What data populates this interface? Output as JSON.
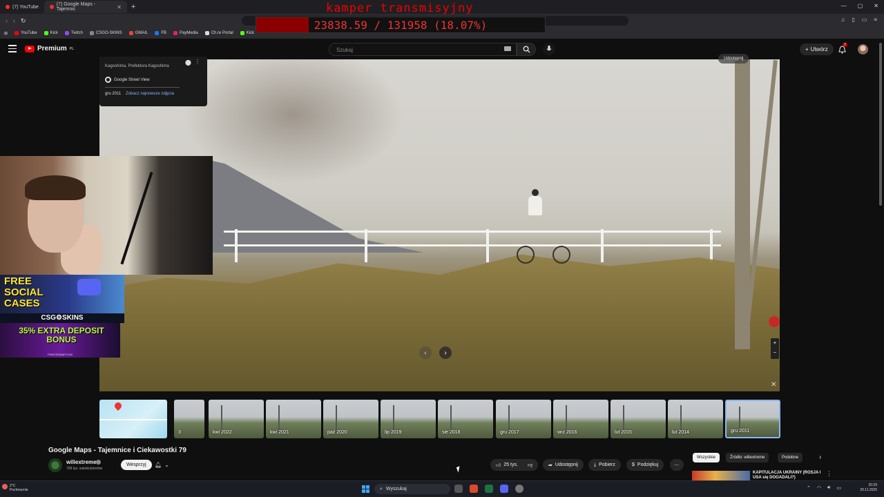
{
  "browser": {
    "tabs": [
      {
        "label": "(7) YouTube",
        "active": false
      },
      {
        "label": "(7) Google Maps - Tajemnic",
        "active": true
      }
    ],
    "bookmarks": [
      "YouTube",
      "Kick",
      "Twitch",
      "CSGO-SKINS",
      "GMAIL",
      "FB",
      "PayMedia",
      "Ch.re Portal",
      "Kick"
    ]
  },
  "stream_overlay": {
    "title": "kamper transmisyjny",
    "goal_text": "23838.59 / 131958 (18.07%)",
    "goal_fraction": 0.1807,
    "accent": "#e00000"
  },
  "youtube": {
    "logo": "Premium",
    "region": "PL",
    "search_placeholder": "Szukaj",
    "create_label": "Utwórz",
    "notifications_count": "7"
  },
  "street_view_card": {
    "place": "Kagoshima, Prefektura Kagoshima",
    "provider": "Google Street View",
    "date": "gru 2011",
    "newer_link": "Zobacz najnowsze zdjęcia",
    "share_label": "Udostępnij"
  },
  "ads": {
    "social_cases": "FREE SOCIAL CASES",
    "csgo_skins": "CSG⚙SKINS",
    "pirate_bonus": "35% EXTRA DEPOSIT BONUS",
    "pirate_site": "PIRATESWAP.COM"
  },
  "timeline": [
    {
      "label": "",
      "kind": "map"
    },
    {
      "label": "3",
      "kind": "partial"
    },
    {
      "label": "kwi 2022"
    },
    {
      "label": "kwi 2021"
    },
    {
      "label": "paź 2020"
    },
    {
      "label": "lip 2019"
    },
    {
      "label": "sie 2018"
    },
    {
      "label": "gru 2017"
    },
    {
      "label": "wrz 2016"
    },
    {
      "label": "lut 2015"
    },
    {
      "label": "lut 2014"
    },
    {
      "label": "gru 2011",
      "selected": true
    }
  ],
  "video": {
    "title": "Google Maps - Tajemnice i Ciekawostki 79",
    "channel": "wiliextreme",
    "subscribers": "799 tys. subskrybentów",
    "support_label": "Wesprzyj",
    "likes": "25 tys.",
    "share_label": "Udostępnij",
    "download_label": "Pobierz",
    "thanks_label": "Podziękuj"
  },
  "chips": [
    "Wszystkie",
    "Źródło: wiliextreme",
    "Podobne"
  ],
  "recommended": {
    "title": "KAPITULACJA UKRAINY (ROSJA I USA się DOGADALI?)"
  },
  "taskbar": {
    "weather_temp": "2°C",
    "weather_desc": "Pochmurnie",
    "search_label": "Wyszukaj",
    "time": "20:29",
    "date": "20.11.2025"
  }
}
